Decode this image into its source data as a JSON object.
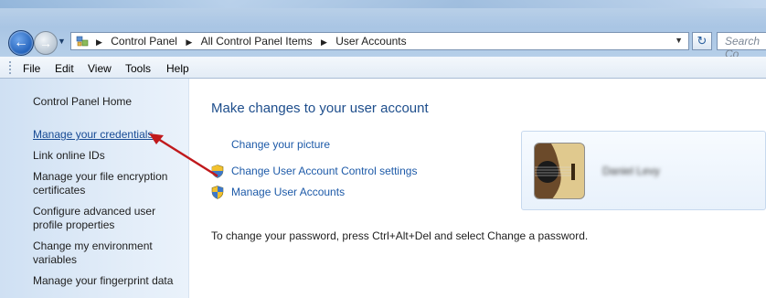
{
  "address_bar": {
    "crumbs": [
      "Control Panel",
      "All Control Panel Items",
      "User Accounts"
    ],
    "search_placeholder": "Search Co"
  },
  "menu": {
    "items": [
      "File",
      "Edit",
      "View",
      "Tools",
      "Help"
    ]
  },
  "sidebar": {
    "items": [
      {
        "label": "Control Panel Home"
      },
      {
        "label": "Manage your credentials"
      },
      {
        "label": "Link online IDs"
      },
      {
        "label": "Manage your file encryption certificates"
      },
      {
        "label": "Configure advanced user profile properties"
      },
      {
        "label": "Change my environment variables"
      },
      {
        "label": "Manage your fingerprint data"
      }
    ]
  },
  "main": {
    "title": "Make changes to your user account",
    "tasks": [
      {
        "label": "Change your picture",
        "icon": "none"
      },
      {
        "label": "Change User Account Control settings",
        "icon": "uac-shield-icon"
      },
      {
        "label": "Manage User Accounts",
        "icon": "uac-shield-icon"
      }
    ],
    "password_note": "To change your password, press Ctrl+Alt+Del and select Change a password."
  },
  "user_card": {
    "name": "Daniel Levy"
  },
  "colors": {
    "link": "#1d5aa8",
    "title": "#1e4e8c",
    "annotation_arrow": "#c0191c"
  }
}
